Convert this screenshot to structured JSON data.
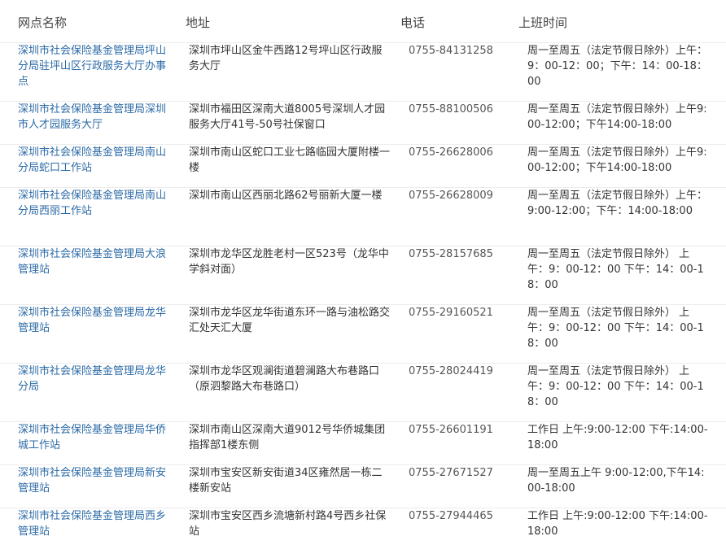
{
  "table": {
    "headers": {
      "name": "网点名称",
      "address": "地址",
      "phone": "电话",
      "hours": "上班时间"
    },
    "rows": [
      {
        "name": "深圳市社会保险基金管理局坪山分局驻坪山区行政服务大厅办事点",
        "address": "深圳市坪山区金牛西路12号坪山区行政服务大厅",
        "phone": "0755-84131258",
        "hours": "周一至周五（法定节假日除外）上午：9：00-12：00；下午：14：00-18：00"
      },
      {
        "name": "深圳市社会保险基金管理局深圳市人才园服务大厅",
        "address": "深圳市福田区深南大道8005号深圳人才园服务大厅41号-50号社保窗口",
        "phone": "0755-88100506",
        "hours": "周一至周五（法定节假日除外）上午9:00-12:00；下午14:00-18:00"
      },
      {
        "name": "深圳市社会保险基金管理局南山分局蛇口工作站",
        "address": "深圳市南山区蛇口工业七路临园大厦附楼一楼",
        "phone": "0755-26628006",
        "hours": "周一至周五（法定节假日除外）上午9:00-12:00；下午14:00-18:00"
      },
      {
        "name": "深圳市社会保险基金管理局南山分局西丽工作站",
        "address": "深圳市南山区西丽北路62号丽新大厦一楼",
        "phone": "0755-26628009",
        "hours": "周一至周五（法定节假日除外）上午：9:00-12:00；下午：14:00-18:00"
      },
      {
        "name": "深圳市社会保险基金管理局大浪管理站",
        "address": "深圳市龙华区龙胜老村一区523号（龙华中学斜对面）",
        "phone": "0755-28157685",
        "hours": "周一至周五（法定节假日除外） 上午：9：00-12：00 下午：14：00-18：00"
      },
      {
        "name": "深圳市社会保险基金管理局龙华管理站",
        "address": "深圳市龙华区龙华街道东环一路与油松路交汇处天汇大厦",
        "phone": "0755-29160521",
        "hours": "周一至周五（法定节假日除外） 上午：9：00-12：00 下午：14：00-18：00"
      },
      {
        "name": "深圳市社会保险基金管理局龙华分局",
        "address": "深圳市龙华区观澜街道碧澜路大布巷路口（原泗黎路大布巷路口）",
        "phone": "0755-28024419",
        "hours": "周一至周五（法定节假日除外） 上午：9：00-12：00 下午：14：00-18：00"
      },
      {
        "name": "深圳市社会保险基金管理局华侨城工作站",
        "address": "深圳市南山区深南大道9012号华侨城集团指挥部1楼东侧",
        "phone": "0755-26601191",
        "hours": "工作日 上午:9:00-12:00 下午:14:00-18:00"
      },
      {
        "name": "深圳市社会保险基金管理局新安管理站",
        "address": "深圳市宝安区新安街道34区雍然居一栋二楼新安站",
        "phone": "0755-27671527",
        "hours": "周一至周五上午 9:00-12:00,下午14:00-18:00"
      },
      {
        "name": "深圳市社会保险基金管理局西乡管理站",
        "address": "深圳市宝安区西乡流塘新村路4号西乡社保站",
        "phone": "0755-27944465",
        "hours": "工作日 上午:9:00-12:00 下午:14:00-18:00"
      }
    ]
  }
}
